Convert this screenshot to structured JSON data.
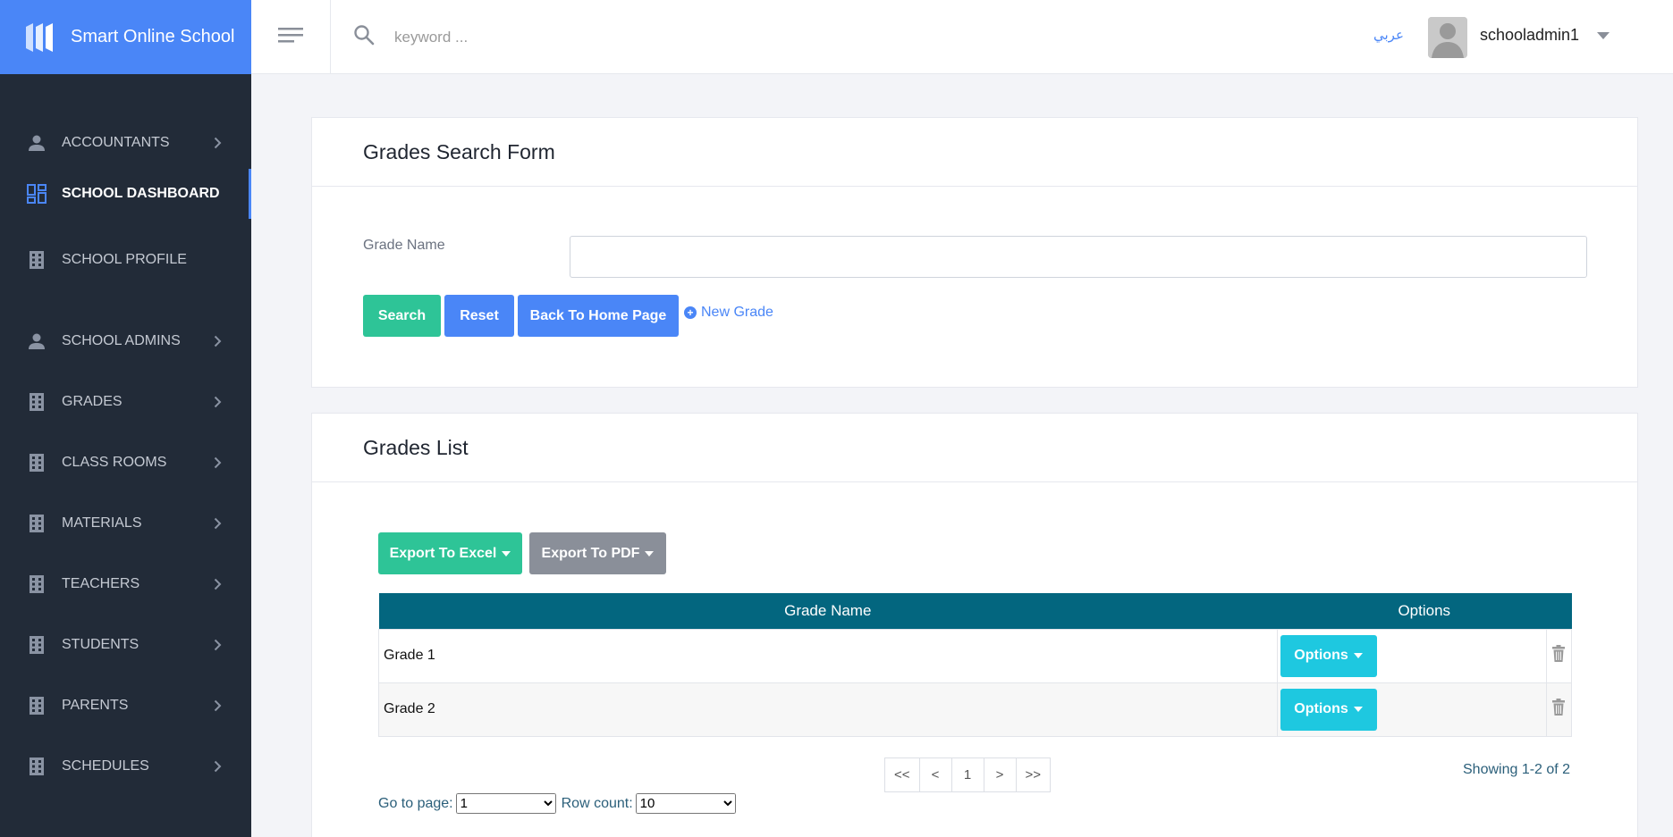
{
  "app": {
    "title": "Smart Online School"
  },
  "header": {
    "search_placeholder": "keyword ...",
    "language_link": "عربي",
    "username": "schooladmin1"
  },
  "sidebar": {
    "items": [
      {
        "label": "ACCOUNTANTS",
        "icon": "person-icon",
        "has_chevron": true,
        "active": false
      },
      {
        "label": "SCHOOL DASHBOARD",
        "icon": "dashboard-icon",
        "has_chevron": false,
        "active": true
      },
      {
        "label": "SCHOOL PROFILE",
        "icon": "building-icon",
        "has_chevron": false,
        "active": false
      },
      {
        "label": "SCHOOL ADMINS",
        "icon": "person-icon",
        "has_chevron": true,
        "active": false
      },
      {
        "label": "GRADES",
        "icon": "building-icon",
        "has_chevron": true,
        "active": false
      },
      {
        "label": "CLASS ROOMS",
        "icon": "building-icon",
        "has_chevron": true,
        "active": false
      },
      {
        "label": "MATERIALS",
        "icon": "building-icon",
        "has_chevron": true,
        "active": false
      },
      {
        "label": "TEACHERS",
        "icon": "building-icon",
        "has_chevron": true,
        "active": false
      },
      {
        "label": "STUDENTS",
        "icon": "building-icon",
        "has_chevron": true,
        "active": false
      },
      {
        "label": "PARENTS",
        "icon": "building-icon",
        "has_chevron": true,
        "active": false
      },
      {
        "label": "SCHEDULES",
        "icon": "building-icon",
        "has_chevron": true,
        "active": false
      }
    ]
  },
  "search_form": {
    "title": "Grades Search Form",
    "grade_name_label": "Grade Name",
    "grade_name_value": "",
    "search_button": "Search",
    "reset_button": "Reset",
    "back_button": "Back To Home Page",
    "new_grade_link": "New Grade"
  },
  "grades_list": {
    "title": "Grades List",
    "export_excel_button": "Export To Excel",
    "export_pdf_button": "Export To PDF",
    "columns": [
      "Grade Name",
      "Options"
    ],
    "rows": [
      {
        "grade_name": "Grade 1",
        "options_label": "Options"
      },
      {
        "grade_name": "Grade 2",
        "options_label": "Options"
      }
    ],
    "pagination": {
      "first": "<<",
      "prev": "<",
      "current": "1",
      "next": ">",
      "last": ">>"
    },
    "showing_text": "Showing 1-2 of 2",
    "go_to_page_label": "Go to page:",
    "go_to_page_value": "1",
    "row_count_label": "Row count:",
    "row_count_value": "10"
  },
  "colors": {
    "brand_blue": "#4a86f7",
    "sidebar_bg": "#222b38",
    "table_header": "#03667f",
    "green": "#2ec497",
    "cyan": "#1ec8e0",
    "gray": "#8a8f99"
  }
}
